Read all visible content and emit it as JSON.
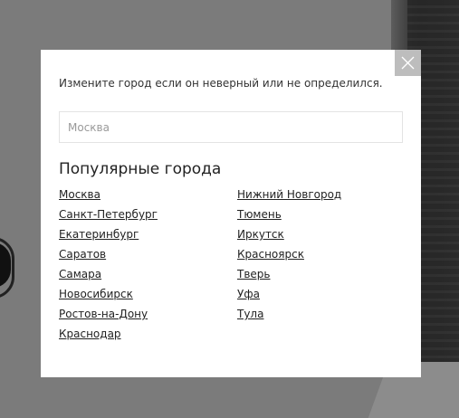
{
  "modal": {
    "close_label": "X",
    "prompt": "Измените город если он неверный или не определился.",
    "search": {
      "value": "",
      "placeholder": "Москва"
    },
    "popular_title": "Популярные города",
    "cities_left": [
      {
        "label": "Москва"
      },
      {
        "label": "Санкт-Петербург"
      },
      {
        "label": "Екатеринбург"
      },
      {
        "label": "Саратов"
      },
      {
        "label": "Самара"
      },
      {
        "label": "Новосибирск"
      },
      {
        "label": "Ростов-на-Дону"
      },
      {
        "label": "Краснодар"
      }
    ],
    "cities_right": [
      {
        "label": "Нижний Новгород"
      },
      {
        "label": "Тюмень"
      },
      {
        "label": "Иркутск"
      },
      {
        "label": "Красноярск"
      },
      {
        "label": "Тверь"
      },
      {
        "label": "Уфа"
      },
      {
        "label": "Тула"
      }
    ]
  },
  "colors": {
    "overlay": "#7b7b7b",
    "modal_bg": "#ffffff",
    "close_bg": "#bdbdbd",
    "text": "#222222"
  },
  "icons": {
    "close": "close-icon"
  }
}
